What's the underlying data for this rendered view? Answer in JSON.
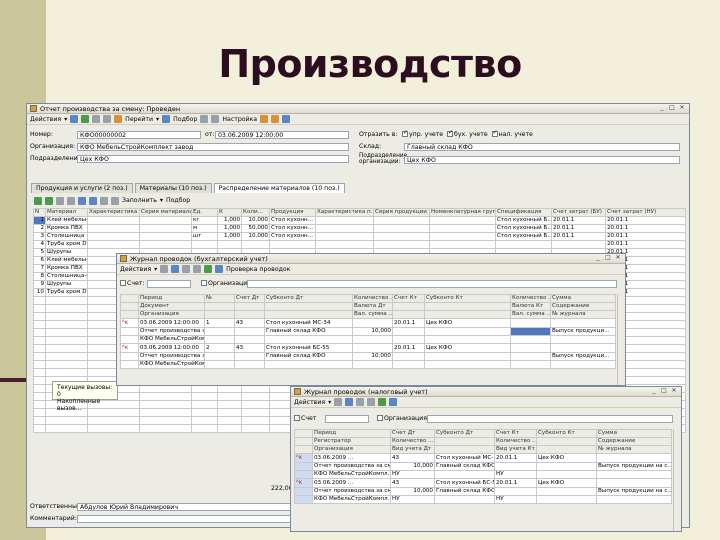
{
  "slide": {
    "title": "Производство"
  },
  "main_window": {
    "title": "Отчет производства за смену: Проведен",
    "toolbar": {
      "actions": "Действия",
      "goto": "Перейти",
      "select": "Подбор",
      "settings": "Настройка"
    },
    "fields": {
      "number_label": "Номер:",
      "number": "КФО00000002",
      "date_label": "от:",
      "date": "03.06.2009 12:00:00",
      "org_label": "Организация:",
      "org": "КФО МебельСтройКомплект завод",
      "dept_label": "Подразделение:",
      "dept": "Цех КФО",
      "reflect_label": "Отразить в:",
      "chk_mgmt": "упр. учете",
      "chk_acc": "бух. учете",
      "chk_tax": "нал. учете",
      "warehouse_label": "Склад:",
      "warehouse": "Главный склад КФО",
      "org_dept_label1": "Подразделение",
      "org_dept_label2": "организации:",
      "org_dept": "Цех КФО"
    },
    "tabs": [
      "Продукция и услуги (2 поз.)",
      "Материалы (10 поз.)",
      "Распределение материалов (10 поз.)"
    ],
    "table_toolbar": {
      "fill": "Заполнить",
      "select": "Подбор"
    },
    "table": {
      "columns": [
        "N",
        "Материал",
        "Характеристика ...",
        "Серия материала",
        "Ед.",
        "К",
        "Коли...",
        "Продукция",
        "Характеристика п...",
        "Серия продукции",
        "Номенклатурная груп...",
        "Спецификация",
        "Счет затрат (БУ)",
        "Счет затрат (НУ)"
      ],
      "rows": [
        [
          "1",
          "Клей мебельный",
          "",
          "",
          "кг",
          "1,000",
          "10,000",
          "Стол кухонн...",
          "",
          "",
          "",
          "Стол кухонный Б...",
          "20.01.1",
          "20.01.1"
        ],
        [
          "2",
          "Кромка ПВХ",
          "",
          "",
          "м",
          "1,000",
          "50,000",
          "Стол кухонн...",
          "",
          "",
          "",
          "Стол кухонный Б...",
          "20.01.1",
          "20.01.1"
        ],
        [
          "3",
          "Столешница",
          "",
          "",
          "шт",
          "1,000",
          "10,000",
          "Стол кухонн...",
          "",
          "",
          "",
          "Стол кухонный Б...",
          "20.01.1",
          "20.01.1"
        ],
        [
          "4",
          "Труба хром D10",
          "",
          "",
          "",
          "",
          "",
          "",
          "",
          "",
          "",
          "",
          "",
          "20.01.1"
        ],
        [
          "5",
          "Шурупы",
          "",
          "",
          "",
          "",
          "",
          "",
          "",
          "",
          "",
          "",
          "",
          "20.01.1"
        ],
        [
          "6",
          "Клей мебельный",
          "",
          "",
          "",
          "",
          "",
          "",
          "",
          "",
          "",
          "",
          "",
          "20.01.1"
        ],
        [
          "7",
          "Кромка ПВХ",
          "",
          "",
          "",
          "",
          "",
          "",
          "",
          "",
          "",
          "",
          "",
          "20.01.1"
        ],
        [
          "8",
          "Столешница-шах...",
          "",
          "",
          "",
          "",
          "",
          "",
          "",
          "",
          "",
          "",
          "",
          "20.01.1"
        ],
        [
          "9",
          "Шурупы",
          "",
          "",
          "",
          "",
          "",
          "",
          "",
          "",
          "",
          "",
          "",
          "20.01.1"
        ],
        [
          "10",
          "Труба хром D10",
          "",
          "",
          "",
          "",
          "",
          "",
          "",
          "",
          "",
          "",
          "",
          "20.01.1"
        ]
      ],
      "total": "222,000"
    },
    "footer": {
      "responsible_label": "Ответственный:",
      "responsible": "Абдулов Юрий Владимирович",
      "comment_label": "Комментарий:"
    }
  },
  "popup": {
    "line1": "Текущие вызовы: 0",
    "line2": "Накопленные вызов..."
  },
  "journal_acc": {
    "title": "Журнал проводок (бухгалтерский учет)",
    "toolbar": {
      "actions": "Действия",
      "check": "Проверка проводок"
    },
    "filter": {
      "account_label": "Счет:",
      "org_label": "Организация:"
    },
    "header1": [
      "",
      "Период",
      "№",
      "Счет Дт",
      "Субконто Дт",
      "Количество ...",
      "Счет Кт",
      "Субконто Кт",
      "Количество ...",
      "Сумма"
    ],
    "header2": [
      "",
      "Документ",
      "",
      "",
      "",
      "Валюта Дт",
      "",
      "",
      "Валюта Кт",
      "Содержание"
    ],
    "header3": [
      "",
      "Организация",
      "",
      "",
      "",
      "Вал. сумма ...",
      "",
      "",
      "Вал. сумма ...",
      "№ журнала"
    ],
    "rows": [
      [
        "03.06.2009 12:00:00",
        "1",
        "43",
        "Стол кухонный МС-34",
        "",
        "20.01.1",
        "Цех КФО",
        "",
        "",
        ""
      ],
      [
        "Отчет производства за смену Ю...",
        "",
        "",
        "Главный склад КФО",
        "10,000",
        "",
        "",
        "",
        "Выпуск продукци..."
      ],
      [
        "КФО МебельСтройКомплект завод",
        "",
        "",
        "",
        "",
        "",
        "",
        "",
        ""
      ],
      [
        "03.06.2009 12:00:00",
        "2",
        "43",
        "Стол кухонный БС-55",
        "",
        "20.01.1",
        "Цех КФО",
        "",
        "",
        ""
      ],
      [
        "Отчет производства за смену Ю...",
        "",
        "",
        "Главный склад КФО",
        "10,000",
        "",
        "",
        "",
        "Выпуск продукци..."
      ],
      [
        "КФО МебельСтройКомплект завод",
        "",
        "",
        "",
        "",
        "",
        "",
        "",
        ""
      ]
    ]
  },
  "journal_tax": {
    "title": "Журнал проводок (налоговый учет)",
    "toolbar": {
      "actions": "Действия"
    },
    "filter": {
      "account_label": "Счет",
      "org_label": "Организация:"
    },
    "header1": [
      "",
      "Период",
      "Счет Дт",
      "Субконто Дт",
      "Счет Кт",
      "Субконто Кт",
      "Сумма"
    ],
    "header2": [
      "",
      "Регистратор",
      "Количество ...",
      "",
      "Количество ...",
      "",
      "Содержание"
    ],
    "header3": [
      "",
      "Организация",
      "Вид учета Дт",
      "",
      "Вид учета Кт",
      "",
      "№ журнала"
    ],
    "rows": [
      [
        "03.06.2009 ...",
        "43",
        "Стол кухонный МС-...",
        "20.01.1",
        "Цех КФО",
        ""
      ],
      [
        "Отчет производства за см...",
        "10,000",
        "Главный склад КФО",
        "",
        "",
        "Выпуск продукции на с..."
      ],
      [
        "КФО МебельСтройКомпл...",
        "НУ",
        "",
        "НУ",
        "",
        ""
      ],
      [
        "03.06.2009 ...",
        "43",
        "Стол кухонный БС-55",
        "20.01.1",
        "Цех КФО",
        ""
      ],
      [
        "Отчет производства за см...",
        "10,000",
        "Главный склад КФО",
        "",
        "",
        "Выпуск продукции на с..."
      ],
      [
        "КФО МебельСтройКомпл...",
        "НУ",
        "",
        "НУ",
        "",
        ""
      ]
    ]
  }
}
